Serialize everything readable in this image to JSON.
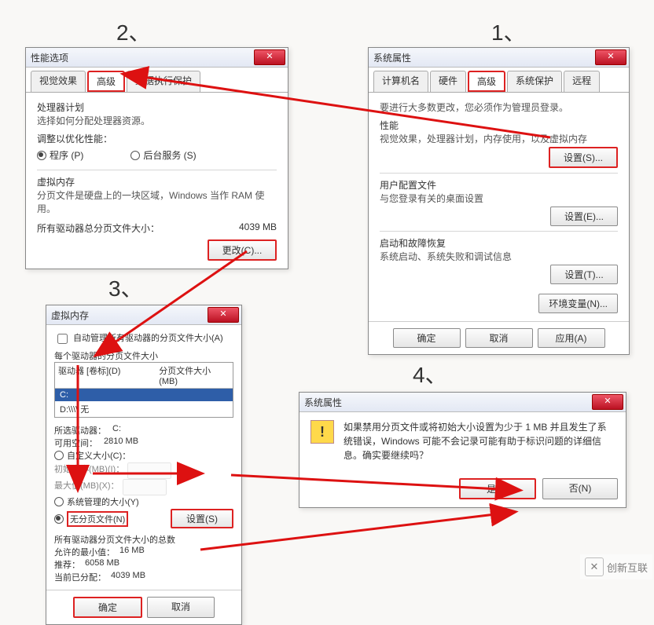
{
  "steps": {
    "s1": "1、",
    "s2": "2、",
    "s3": "3、",
    "s4": "4、"
  },
  "dlg2": {
    "title": "性能选项",
    "tabs": [
      "视觉效果",
      "高级",
      "数据执行保护"
    ],
    "proc_heading": "处理器计划",
    "proc_desc": "选择如何分配处理器资源。",
    "adjust_label": "调整以优化性能：",
    "radio_programs": "程序 (P)",
    "radio_services": "后台服务 (S)",
    "vm_heading": "虚拟内存",
    "vm_desc": "分页文件是硬盘上的一块区域，Windows 当作 RAM 使用。",
    "vm_total_label": "所有驱动器总分页文件大小：",
    "vm_total_value": "4039 MB",
    "change_btn": "更改(C)..."
  },
  "dlg1": {
    "title": "系统属性",
    "tabs": [
      "计算机名",
      "硬件",
      "高级",
      "系统保护",
      "远程"
    ],
    "admin_note": "要进行大多数更改，您必须作为管理员登录。",
    "perf_heading": "性能",
    "perf_desc": "视觉效果，处理器计划，内存使用，以及虚拟内存",
    "perf_btn": "设置(S)...",
    "user_heading": "用户配置文件",
    "user_desc": "与您登录有关的桌面设置",
    "user_btn": "设置(E)...",
    "startup_heading": "启动和故障恢复",
    "startup_desc": "系统启动、系统失败和调试信息",
    "startup_btn": "设置(T)...",
    "env_btn": "环境变量(N)...",
    "ok": "确定",
    "cancel": "取消",
    "apply": "应用(A)"
  },
  "dlg3": {
    "title": "虚拟内存",
    "chk_auto": "自动管理所有驱动器的分页文件大小(A)",
    "per_drive_label": "每个驱动器的分页文件大小",
    "col_drive": "驱动器 [卷标](D)",
    "col_size": "分页文件大小 (MB)",
    "row_sel": "C:",
    "row_other": "D:\\\\\\\\                         无",
    "sel_drive_label": "所选驱动器：",
    "sel_drive_val": "C:",
    "space_label": "可用空间：",
    "space_val": "2810 MB",
    "radio_custom": "自定义大小(C)：",
    "init_label": "初始大小(MB)(I)：",
    "max_label": "最大值(MB)(X)：",
    "radio_sys": "系统管理的大小(Y)",
    "radio_none": "无分页文件(N)",
    "set_btn": "设置(S)",
    "summary_label": "所有驱动器分页文件大小的总数",
    "min_label": "允许的最小值：",
    "min_val": "16 MB",
    "rec_label": "推荐：",
    "rec_val": "6058 MB",
    "cur_label": "当前已分配：",
    "cur_val": "4039 MB",
    "ok": "确定",
    "cancel": "取消"
  },
  "dlg4": {
    "title": "系统属性",
    "msg": "如果禁用分页文件或将初始大小设置为少于 1 MB 并且发生了系统错误，Windows 可能不会记录可能有助于标识问题的详细信息。确实要继续吗？",
    "yes": "是(Y)",
    "no": "否(N)"
  },
  "watermark": "创新互联"
}
